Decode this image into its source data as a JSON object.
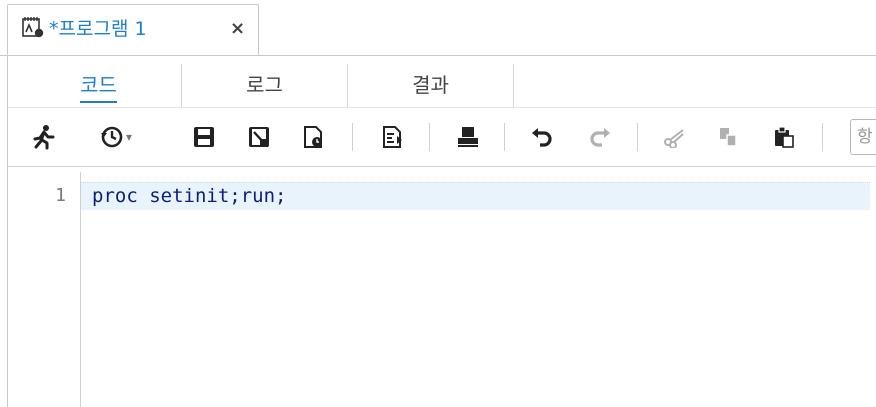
{
  "doc_tab": {
    "title": "*프로그램 1",
    "close": "×",
    "icon": "program-icon"
  },
  "subtabs": [
    {
      "label": "코드",
      "active": true
    },
    {
      "label": "로그",
      "active": false
    },
    {
      "label": "결과",
      "active": false
    }
  ],
  "toolbar": {
    "buttons": [
      "run-icon",
      "history-icon",
      "save-icon",
      "save-as-icon",
      "open-icon",
      "format-code-icon",
      "print-icon",
      "undo-icon",
      "redo-icon",
      "cut-icon",
      "copy-icon",
      "paste-icon"
    ],
    "history_caret": "▾",
    "search_field_text": "항"
  },
  "editor": {
    "lines": [
      {
        "number": "1",
        "text": "proc setinit;run;"
      }
    ]
  },
  "colors": {
    "accent": "#1e7fcb",
    "code": "#0b1f7a",
    "current_line": "#e9f3fb"
  }
}
